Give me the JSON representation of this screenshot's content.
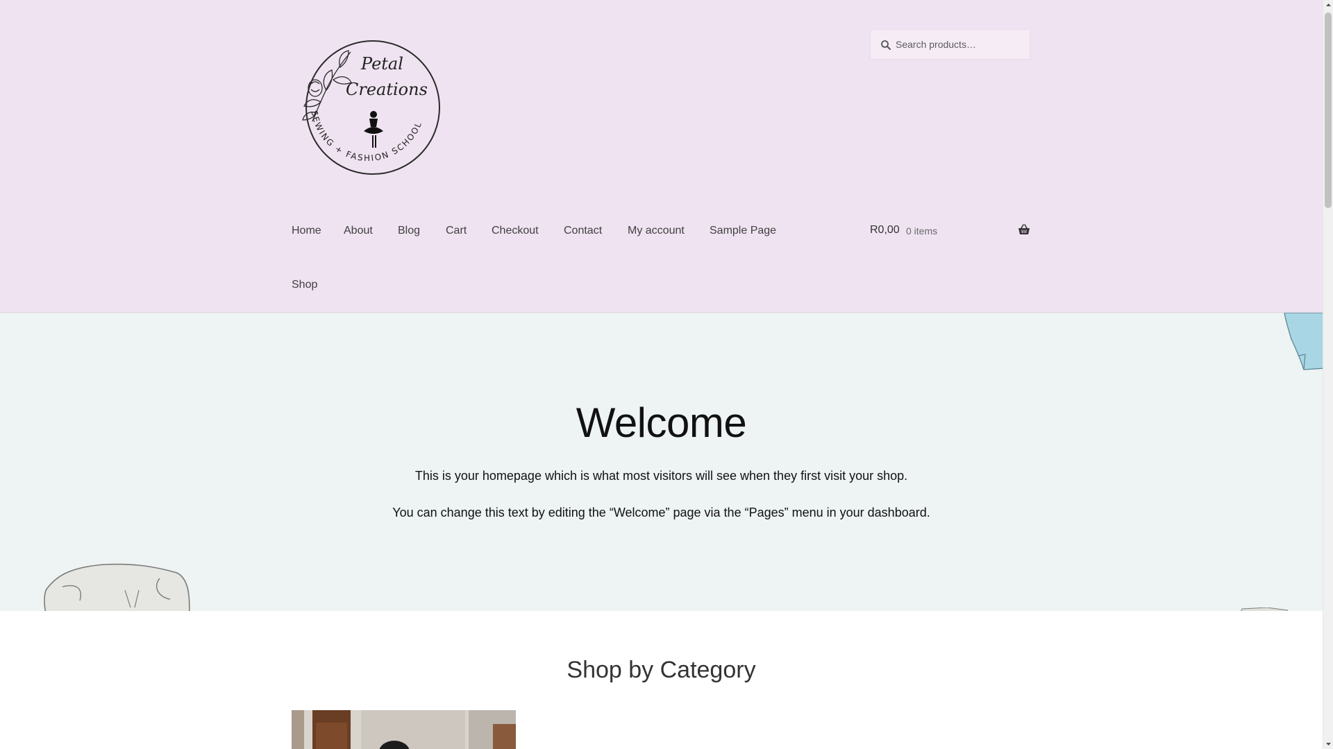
{
  "header": {
    "logo": {
      "script_line1": "Petal",
      "script_line2": "Creations",
      "ring_text": "SEWING + FASHION SCHOOL"
    },
    "search": {
      "placeholder": "Search products…"
    },
    "nav": {
      "items": [
        {
          "label": "Home"
        },
        {
          "label": "About"
        },
        {
          "label": "Blog"
        },
        {
          "label": "Cart"
        },
        {
          "label": "Checkout"
        },
        {
          "label": "Contact"
        },
        {
          "label": "My account"
        },
        {
          "label": "Sample Page"
        },
        {
          "label": "Shop"
        }
      ]
    },
    "cart": {
      "amount": "R0,00",
      "count": "0 items"
    }
  },
  "hero": {
    "title": "Welcome",
    "text1": "This is your homepage which is what most visitors will see when they first visit your shop.",
    "text2": "You can change this text by editing the “Welcome” page via the “Pages” menu in your dashboard."
  },
  "categories": {
    "title": "Shop by Category"
  },
  "icons": {
    "search": "search-icon",
    "basket": "basket-icon",
    "scroll_up": "scroll-up-arrow-icon",
    "scroll_down": "scroll-down-arrow-icon"
  },
  "colors": {
    "header_bg": "#efe3f1",
    "hero_bg": "#eef3f4",
    "text": "#404040"
  }
}
